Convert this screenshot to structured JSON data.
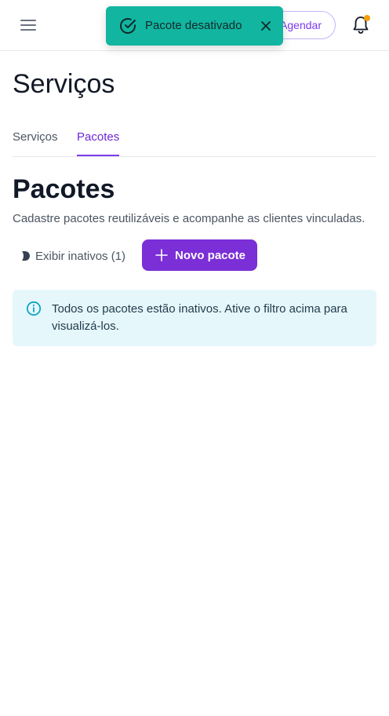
{
  "header": {
    "schedule_label": "Agendar"
  },
  "toast": {
    "message": "Pacote desativado"
  },
  "page": {
    "title": "Serviços"
  },
  "tabs": [
    {
      "label": "Serviços",
      "active": false
    },
    {
      "label": "Pacotes",
      "active": true
    }
  ],
  "section": {
    "title": "Pacotes",
    "description": "Cadastre pacotes reutilizáveis e acompanhe as clientes vinculadas."
  },
  "filter": {
    "show_inactive_label": "Exibir inativos (1)",
    "checked": false
  },
  "actions": {
    "new_package_label": "Novo pacote"
  },
  "alert": {
    "message": "Todos os pacotes estão inativos. Ative o filtro acima para visualizá-los."
  },
  "colors": {
    "accent": "#7b2fd6",
    "toast_bg": "#12b5a0",
    "alert_bg": "#e6f7fb",
    "notification_dot": "#f59e0b"
  }
}
